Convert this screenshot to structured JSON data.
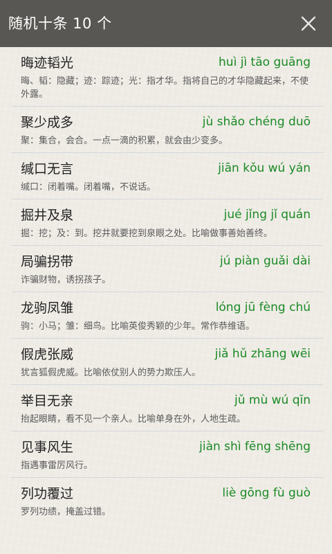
{
  "header": {
    "title": "随机十条  10 个"
  },
  "colors": {
    "titlebar": "#585753",
    "pinyin": "#1a8a25",
    "divider": "#d3d7da"
  },
  "items": [
    {
      "word": "晦迹韬光",
      "pinyin": "huì jì tāo guāng",
      "desc": "晦、韬：隐藏；迹：踪迹；光：指才华。指将自己的才华隐藏起来，不使外露。"
    },
    {
      "word": "聚少成多",
      "pinyin": "jù shǎo chéng duō",
      "desc": "聚：集合，会合。一点一滴的积累，就会由少变多。"
    },
    {
      "word": "缄口无言",
      "pinyin": "jiān kǒu wú yán",
      "desc": "缄口：闭着嘴。闭着嘴，不说话。"
    },
    {
      "word": "掘井及泉",
      "pinyin": "jué jǐng jǐ quán",
      "desc": "掘：挖；及：到。挖井就要挖到泉眼之处。比喻做事善始善终。"
    },
    {
      "word": "局骗拐带",
      "pinyin": "jú piàn guǎi dài",
      "desc": "诈骗财物，诱拐孩子。"
    },
    {
      "word": "龙驹凤雏",
      "pinyin": "lóng jū fèng chú",
      "desc": "驹：小马；雏：细鸟。比喻英俊秀颖的少年。常作恭维语。"
    },
    {
      "word": "假虎张威",
      "pinyin": "jiǎ hǔ zhāng wēi",
      "desc": "犹言狐假虎威。比喻依仗别人的势力欺压人。"
    },
    {
      "word": "举目无亲",
      "pinyin": "jǔ mù wú qīn",
      "desc": "抬起眼睛，看不见一个亲人。比喻单身在外，人地生疏。"
    },
    {
      "word": "见事风生",
      "pinyin": "jiàn shì fēng shēng",
      "desc": "指遇事雷厉风行。"
    },
    {
      "word": "列功覆过",
      "pinyin": "liè gōng fù guò",
      "desc": "罗列功绩，掩盖过错。"
    }
  ]
}
